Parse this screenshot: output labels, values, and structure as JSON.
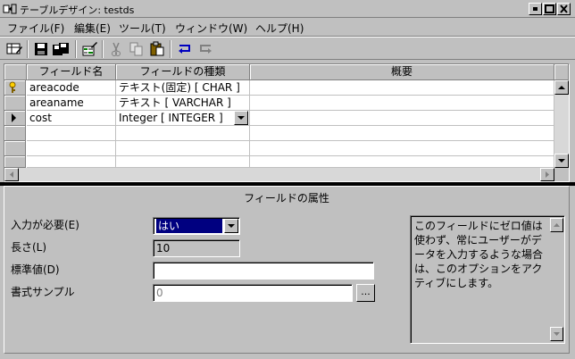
{
  "window": {
    "title": "テーブルデザイン:  testds",
    "controls": [
      "minimize",
      "maximize",
      "close"
    ]
  },
  "menu": [
    "ファイル(F)",
    "編集(E)",
    "ツール(T)",
    "ウィンドウ(W)",
    "ヘルプ(H)"
  ],
  "toolbar": {
    "icons": [
      "table-design-icon",
      "save-icon",
      "save-as-icon",
      "edit-data-icon",
      "cut-icon",
      "copy-icon",
      "paste-icon",
      "undo-icon",
      "redo-icon"
    ]
  },
  "grid": {
    "columns": [
      "フィールド名",
      "フィールドの種類",
      "概要"
    ],
    "rows": [
      {
        "marker": "key",
        "name": "areacode",
        "type": "テキスト(固定) [ CHAR ]",
        "desc": ""
      },
      {
        "marker": "",
        "name": "areaname",
        "type": "テキスト [ VARCHAR ]",
        "desc": ""
      },
      {
        "marker": "current",
        "name": "cost",
        "type": "Integer [ INTEGER ]",
        "desc": ""
      },
      {
        "marker": "",
        "name": "",
        "type": "",
        "desc": ""
      },
      {
        "marker": "",
        "name": "",
        "type": "",
        "desc": ""
      },
      {
        "marker": "",
        "name": "",
        "type": "",
        "desc": ""
      }
    ]
  },
  "props": {
    "title": "フィールドの属性",
    "required_label": "入力が必要(E)",
    "required_value": "はい",
    "length_label": "長さ(L)",
    "length_value": "10",
    "default_label": "標準値(D)",
    "default_value": "",
    "format_label": "書式サンプル",
    "format_value": "0",
    "format_button": "...",
    "help": "このフィールドにゼロ値は使わず、常にユーザーがデータを入力するような場合は、このオプションをアクティブにします。"
  },
  "colors": {
    "face": "#c0c0c0",
    "selection": "#000080"
  }
}
